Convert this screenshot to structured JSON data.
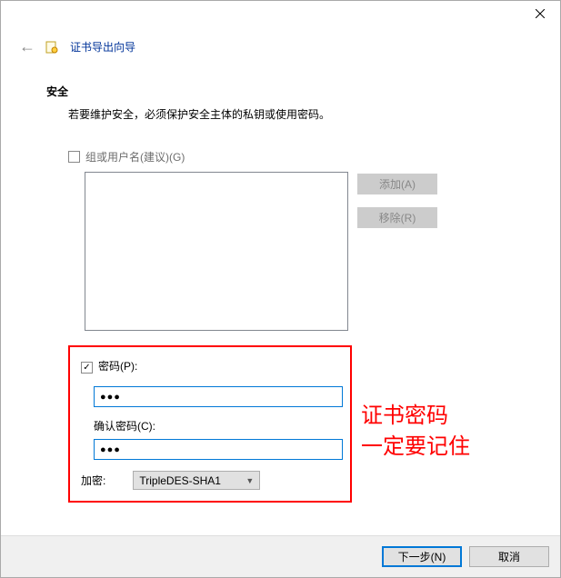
{
  "window": {
    "title": "证书导出向导"
  },
  "security": {
    "heading": "安全",
    "description": "若要维护安全，必须保护安全主体的私钥或使用密码。"
  },
  "group": {
    "checkbox_label": "组或用户名(建议)(G)"
  },
  "buttons": {
    "add": "添加(A)",
    "remove": "移除(R)"
  },
  "password": {
    "checkbox_label": "密码(P):",
    "value": "●●●",
    "confirm_label": "确认密码(C):",
    "confirm_value": "●●●"
  },
  "encryption": {
    "label": "加密:",
    "selected": "TripleDES-SHA1"
  },
  "annotation": {
    "line1": "证书密码",
    "line2": "一定要记住"
  },
  "footer": {
    "next": "下一步(N)",
    "cancel": "取消"
  }
}
